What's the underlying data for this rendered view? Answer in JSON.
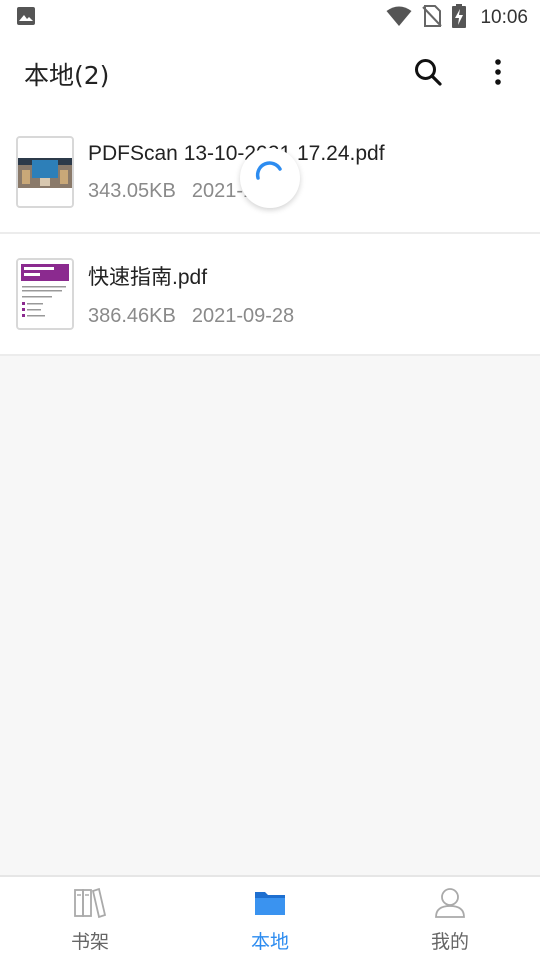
{
  "status_bar": {
    "time": "10:06",
    "icons": [
      "image-icon",
      "wifi-icon",
      "no-sim-icon",
      "battery-charging-icon"
    ]
  },
  "app_bar": {
    "title": "本地(2)",
    "actions": [
      "search-icon",
      "more-vert-icon"
    ]
  },
  "files": [
    {
      "name": "PDFScan 13-10-2021 17.24.pdf",
      "size": "343.05KB",
      "date": "2021-10-13"
    },
    {
      "name": "快速指南.pdf",
      "size": "386.46KB",
      "date": "2021-09-28"
    }
  ],
  "loading": {
    "icon": "spinner-icon",
    "color": "#2d8cf0"
  },
  "bottom_nav": {
    "active_color": "#2d8cf0",
    "items": [
      {
        "label": "书架",
        "icon": "bookshelf-icon",
        "active": false
      },
      {
        "label": "本地",
        "icon": "folder-icon",
        "active": true
      },
      {
        "label": "我的",
        "icon": "person-icon",
        "active": false
      }
    ]
  }
}
